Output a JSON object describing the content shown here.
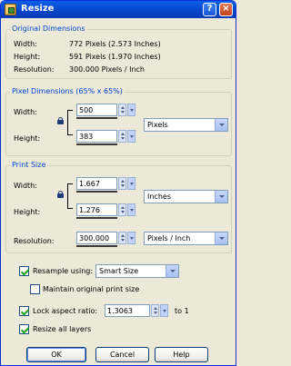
{
  "window": {
    "title": "Resize",
    "help_button": "?",
    "close_button": "×"
  },
  "original": {
    "group_label": "Original Dimensions",
    "width_label": "Width:",
    "width_value": "772 Pixels (2.573 Inches)",
    "height_label": "Height:",
    "height_value": "591 Pixels (1.970 Inches)",
    "resolution_label": "Resolution:",
    "resolution_value": "300.000 Pixels / Inch"
  },
  "pixel": {
    "group_label": "Pixel Dimensions (65% x 65%)",
    "width_label": "Width:",
    "width_value": "500",
    "height_label": "Height:",
    "height_value": "383",
    "units": "Pixels"
  },
  "print": {
    "group_label": "Print Size",
    "width_label": "Width:",
    "width_value": "1.667",
    "height_label": "Height:",
    "height_value": "1.276",
    "units": "Inches",
    "resolution_label": "Resolution:",
    "resolution_value": "300.000",
    "resolution_units": "Pixels / Inch"
  },
  "options": {
    "resample_label": "Resample using:",
    "resample_checked": true,
    "resample_method": "Smart Size",
    "maintain_label": "Maintain original print size",
    "maintain_checked": false,
    "lock_label": "Lock aspect ratio:",
    "lock_checked": true,
    "lock_value": "1.3063",
    "lock_suffix": "to 1",
    "resize_layers_label": "Resize all layers",
    "resize_layers_checked": true
  },
  "buttons": {
    "ok": "OK",
    "cancel": "Cancel",
    "help": "Help"
  },
  "colors": {
    "title_bar": "#0845c9",
    "group_label": "#0046d5",
    "dialog_bg": "#ece9d8"
  }
}
